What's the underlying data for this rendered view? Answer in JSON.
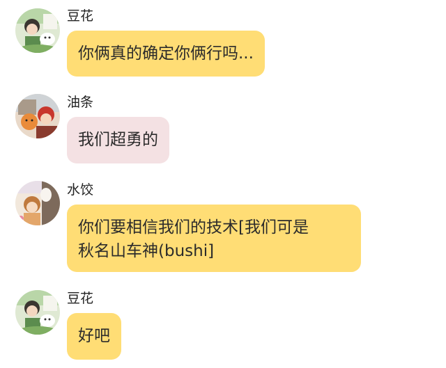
{
  "messages": [
    {
      "sender": "豆花",
      "avatar": "avatar-douhua",
      "bubble_color": "#ffdd75",
      "text": "你俩真的确定你俩行吗..."
    },
    {
      "sender": "油条",
      "avatar": "avatar-youtiao",
      "bubble_color": "#f4e1e3",
      "text": "我们超勇的"
    },
    {
      "sender": "水饺",
      "avatar": "avatar-shuijiao",
      "bubble_color": "#ffdd75",
      "lines": [
        "你们要相信我们的技术[我们可是",
        "秋名山车神(bushi]"
      ]
    },
    {
      "sender": "豆花",
      "avatar": "avatar-douhua",
      "bubble_color": "#ffdd75",
      "text": "好吧"
    }
  ]
}
